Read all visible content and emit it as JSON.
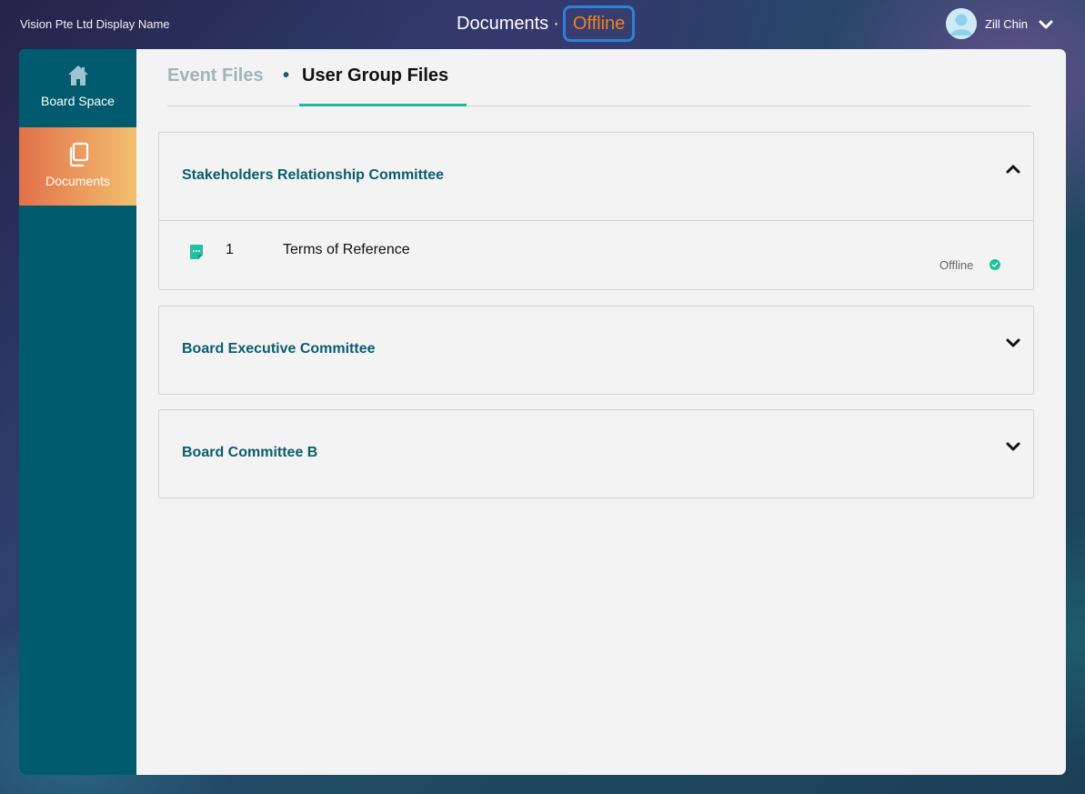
{
  "topbar": {
    "org_name": "Vision Pte Ltd Display Name",
    "page_title": "Documents",
    "separator": "·",
    "status_badge": "Offline",
    "user_name": "Zill Chin"
  },
  "sidebar": {
    "items": [
      {
        "label": "Board Space",
        "icon": "home-icon",
        "active": false
      },
      {
        "label": "Documents",
        "icon": "documents-icon",
        "active": true
      }
    ]
  },
  "tabs": {
    "items": [
      {
        "label": "Event Files",
        "active": false
      },
      {
        "label": "User Group Files",
        "active": true
      }
    ],
    "separator": "•"
  },
  "groups": [
    {
      "title": "Stakeholders Relationship Committee",
      "expanded": true,
      "documents": [
        {
          "number": "1",
          "title": "Terms of Reference",
          "status": "Offline",
          "icon": "annotation-note-icon"
        }
      ]
    },
    {
      "title": "Board Executive Committee",
      "expanded": false,
      "documents": []
    },
    {
      "title": "Board Committee B",
      "expanded": false,
      "documents": []
    }
  ],
  "colors": {
    "sidebar_bg": "#005b6e",
    "active_nav_gradient": [
      "#e2704a",
      "#f2c06e"
    ],
    "group_title": "#0b5c6d",
    "tab_underline": "#1fb89a",
    "offline_text": "#f0821e",
    "offline_border": "#2f80d8",
    "status_ok": "#1fc29a"
  }
}
